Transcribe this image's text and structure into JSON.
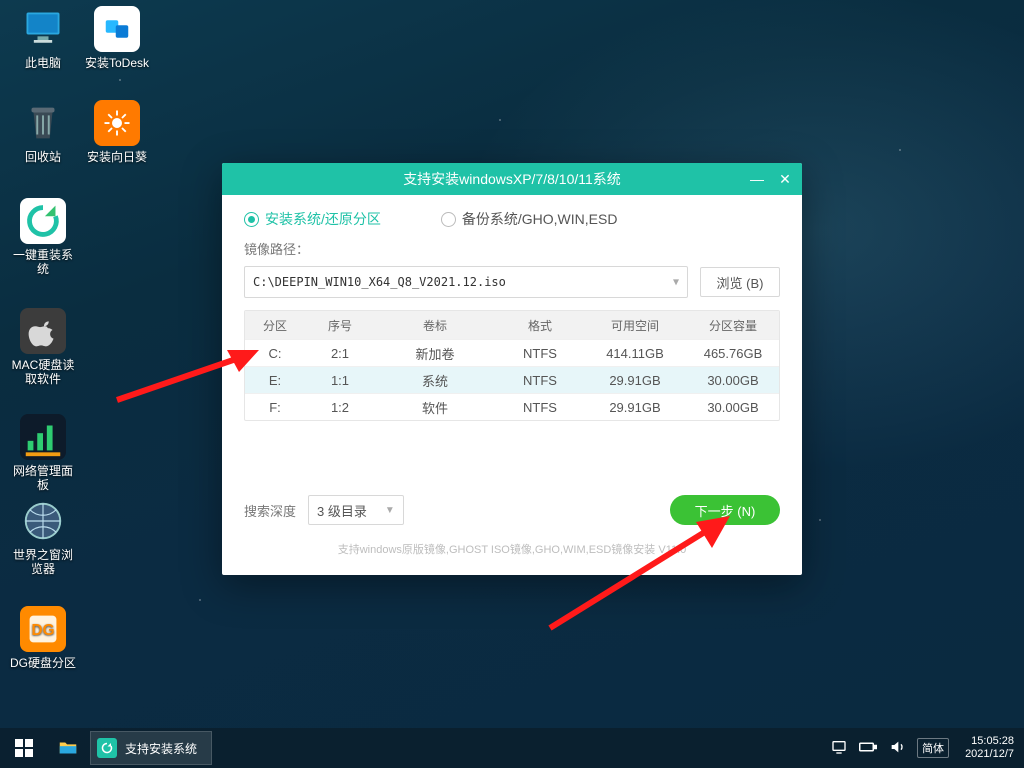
{
  "desktop_icons": {
    "this_pc": "此电脑",
    "todesk": "安装ToDesk",
    "recycle": "回收站",
    "sunflower": "安装向日葵",
    "reinstall": "一键重装系统",
    "mac": "MAC硬盘读取软件",
    "netpanel": "网络管理面板",
    "browser": "世界之窗浏览器",
    "dg": "DG硬盘分区"
  },
  "window": {
    "title": "支持安装windowsXP/7/8/10/11系统",
    "tab_install": "安装系统/还原分区",
    "tab_backup": "备份系统/GHO,WIN,ESD",
    "image_path_label": "镜像路径：",
    "image_path": "C:\\DEEPIN_WIN10_X64_Q8_V2021.12.iso",
    "browse": "浏览 (B)",
    "headers": {
      "part": "分区",
      "seq": "序号",
      "label": "卷标",
      "fmt": "格式",
      "free": "可用空间",
      "size": "分区容量"
    },
    "rows": [
      {
        "part": "C:",
        "seq": "2:1",
        "label": "新加卷",
        "fmt": "NTFS",
        "free": "414.11GB",
        "size": "465.76GB"
      },
      {
        "part": "E:",
        "seq": "1:1",
        "label": "系统",
        "fmt": "NTFS",
        "free": "29.91GB",
        "size": "30.00GB"
      },
      {
        "part": "F:",
        "seq": "1:2",
        "label": "软件",
        "fmt": "NTFS",
        "free": "29.91GB",
        "size": "30.00GB"
      }
    ],
    "search_depth_label": "搜索深度",
    "search_depth_value": "3 级目录",
    "next": "下一步 (N)",
    "support_text": "支持windows原版镜像,GHOST ISO镜像,GHO,WIM,ESD镜像安装 V11.0"
  },
  "taskbar": {
    "task_title": "支持安装系统",
    "ime": "简体",
    "time": "15:05:28",
    "date": "2021/12/7"
  }
}
